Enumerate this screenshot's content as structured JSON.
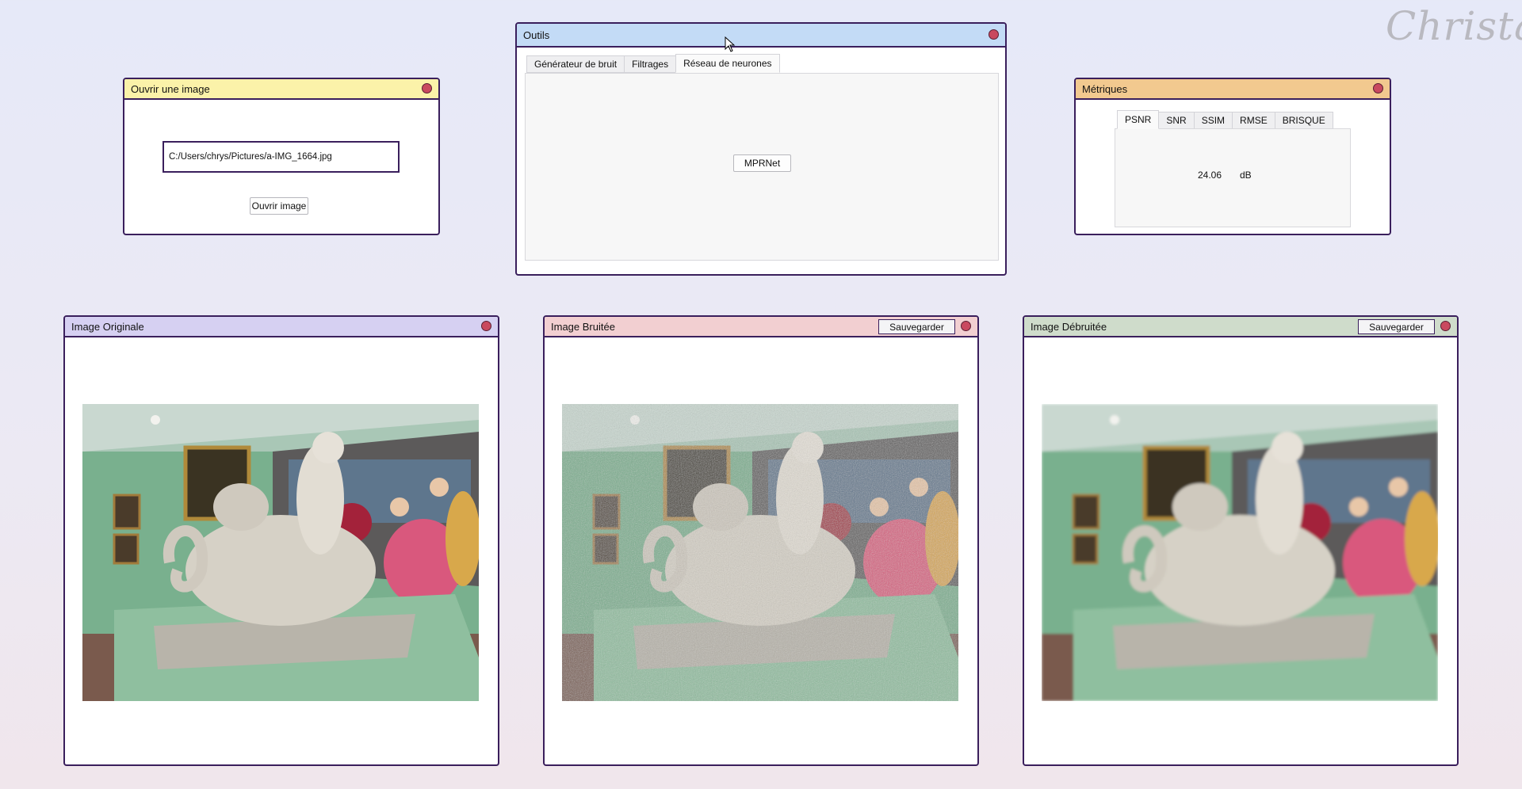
{
  "brand": {
    "logo_text": "Christal"
  },
  "open_image": {
    "title": "Ouvrir une image",
    "path_value": "C:/Users/chrys/Pictures/a-IMG_1664.jpg",
    "button_label": "Ouvrir image"
  },
  "tools": {
    "title": "Outils",
    "tabs": [
      {
        "label": "Générateur de bruit",
        "active": false
      },
      {
        "label": "Filtrages",
        "active": false
      },
      {
        "label": "Réseau de neurones",
        "active": true
      }
    ],
    "model_button_label": "MPRNet"
  },
  "metrics": {
    "title": "Métriques",
    "tabs": [
      {
        "label": "PSNR",
        "active": true
      },
      {
        "label": "SNR",
        "active": false
      },
      {
        "label": "SSIM",
        "active": false
      },
      {
        "label": "RMSE",
        "active": false
      },
      {
        "label": "BRISQUE",
        "active": false
      }
    ],
    "value": "24.06",
    "unit": "dB"
  },
  "panels": {
    "original": {
      "title": "Image Originale",
      "color": "#d6d0f2"
    },
    "noisy": {
      "title": "Image Bruitée",
      "save_label": "Sauvegarder",
      "color": "#f2cfd1"
    },
    "denoised": {
      "title": "Image Débruitée",
      "save_label": "Sauvegarder",
      "color": "#cfdccb"
    }
  },
  "window_colors": {
    "open_image": "#fbf2a9",
    "tools": "#c3dbf6",
    "metrics": "#f2c98f"
  }
}
